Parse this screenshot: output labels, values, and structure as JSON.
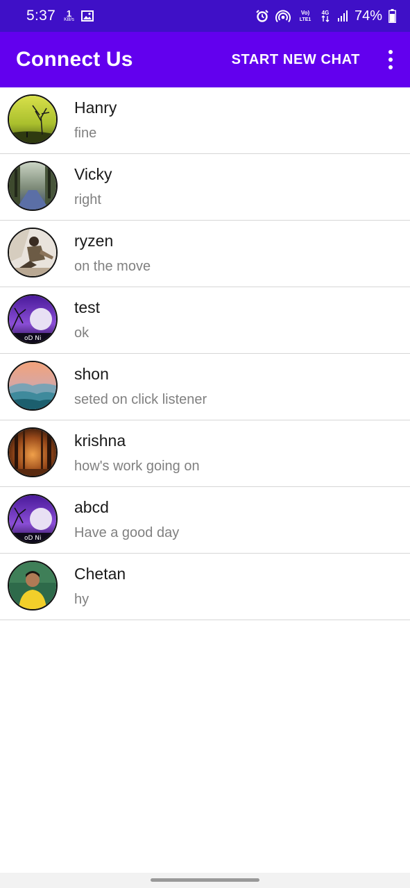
{
  "status_bar": {
    "time": "5:37",
    "net_speed_value": "1",
    "net_speed_unit": "KB/s",
    "volte_label": "Vo) LTE1",
    "network_label": "4G",
    "battery_percent": "74%",
    "icons": [
      "gallery-icon",
      "alarm-icon",
      "hotspot-icon",
      "volte-icon",
      "4g-data-icon",
      "signal-icon",
      "battery-icon"
    ]
  },
  "app_bar": {
    "title": "Connect Us",
    "action_label": "START NEW CHAT",
    "overflow_icon": "more-vert-icon",
    "color": "#6200ee"
  },
  "chats": [
    {
      "name": "Hanry",
      "last_message": "fine",
      "avatar": "sunset-tree"
    },
    {
      "name": "Vicky",
      "last_message": "right",
      "avatar": "forest-path"
    },
    {
      "name": "ryzen",
      "last_message": "on the move",
      "avatar": "person-sitting"
    },
    {
      "name": "test",
      "last_message": "ok",
      "avatar": "purple-night"
    },
    {
      "name": "shon",
      "last_message": "seted on click listener",
      "avatar": "misty-mountains"
    },
    {
      "name": "krishna",
      "last_message": "how's work going on",
      "avatar": "autumn-forest"
    },
    {
      "name": "abcd",
      "last_message": "Have a good day",
      "avatar": "purple-night"
    },
    {
      "name": "Chetan",
      "last_message": "hy",
      "avatar": "person-yellow-shirt"
    }
  ],
  "colors": {
    "status_bar": "#3f10c7",
    "app_bar": "#6200ee",
    "divider": "#d6d6d6",
    "name_text": "#1a1a1a",
    "message_text": "#808080"
  }
}
